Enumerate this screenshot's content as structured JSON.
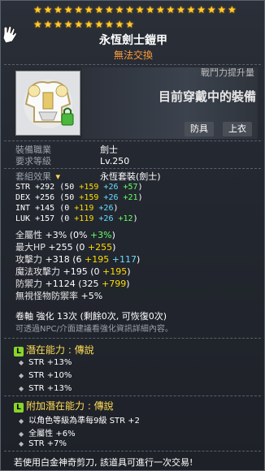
{
  "stars": {
    "row1": 20,
    "row2": 10
  },
  "item": {
    "name": "永恆劍士鎧甲",
    "trade": "無法交換"
  },
  "compare": {
    "label": "戰鬥力提升量",
    "main": "目前穿戴中的裝備",
    "tags": [
      "防具",
      "上衣"
    ]
  },
  "info": {
    "job_label": "裝備職業",
    "job_value": "劍士",
    "level_label": "要求等級",
    "level_value": "Lv.250",
    "set_label": "套組效果",
    "set_value": "永恆套裝(劍士)"
  },
  "stats": [
    {
      "name": "STR",
      "total": "+292",
      "open": " (50 ",
      "a": "+159",
      "b": "+26",
      "c": "+57",
      "close": ")"
    },
    {
      "name": "DEX",
      "total": "+256",
      "open": " (50 ",
      "a": "+159",
      "b": "+26",
      "c": "+21",
      "close": ")"
    },
    {
      "name": "INT",
      "total": "+145",
      "open": " (0 ",
      "a": "+119",
      "b": "+26",
      "c": "",
      "close": ")"
    },
    {
      "name": "LUK",
      "total": "+157",
      "open": " (0 ",
      "a": "+119",
      "b": "+26",
      "c": "+12",
      "close": ")"
    }
  ],
  "extra_stats": [
    {
      "name": "全屬性",
      "val": "+3%",
      "open": " (0% ",
      "g": "+3%",
      "close": ")"
    },
    {
      "name": "最大HP",
      "val": "+255",
      "open": " (0 ",
      "y": "+255",
      "close": ")"
    },
    {
      "name": "攻擊力",
      "val": "+318",
      "open": " (6 ",
      "y": "+195",
      "c": "+117",
      "close": ")"
    },
    {
      "name": "魔法攻擊力",
      "val": "+195",
      "open": " (0 ",
      "y": "+195",
      "close": ")"
    },
    {
      "name": "防禦力",
      "val": "+1124",
      "open": " (325 ",
      "y": "+799",
      "close": ")"
    },
    {
      "name": "無視怪物防禦率",
      "val": "+5%"
    }
  ],
  "scroll": {
    "text": "卷軸 強化 13次 (剩餘0次, 可恢復0次)",
    "note": "可透過NPC/介面建議看強化資訊詳細內容。"
  },
  "potential": {
    "icon": "L",
    "head": "潛在能力 : 傳說",
    "lines": [
      "STR +13%",
      "STR +10%",
      "STR +13%"
    ]
  },
  "add_potential": {
    "icon": "L",
    "head": "附加潛在能力 : 傳說",
    "lines": [
      "以角色等級為準每9級 STR +2",
      "全屬性 +6%",
      "STR +7%"
    ]
  },
  "footer": "若使用白金神奇剪刀, 該道具可進行一次交易!"
}
